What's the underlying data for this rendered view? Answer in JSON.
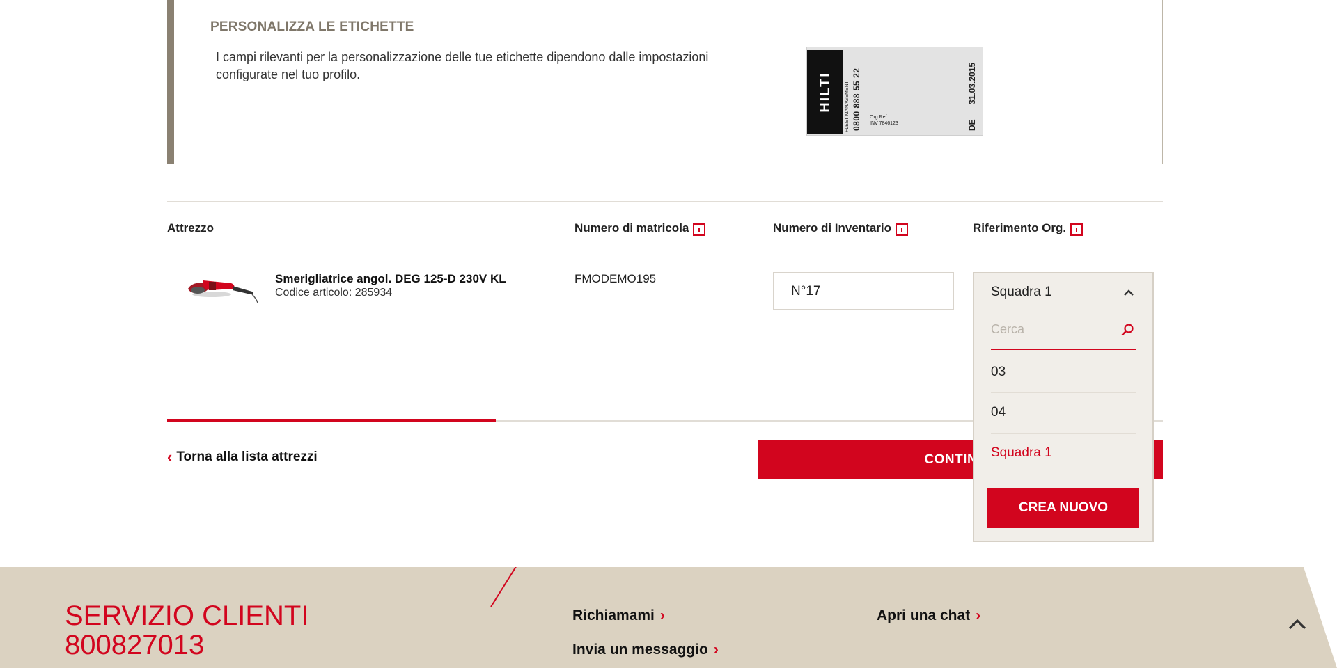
{
  "personalize": {
    "title": "PERSONALIZZA LE ETICHETTE",
    "description": "I campi rilevanti per la personalizzazione delle tue etichette dipendono dalle impostazioni configurate nel tuo profilo."
  },
  "label_sample": {
    "logo": "HILTI",
    "subline": "FLEET MANAGEMENT",
    "phone": "0800 888 55 22",
    "org_ref": "Org.Ref.",
    "org_value": "INV 7846123",
    "country": "DE",
    "date": "31.03.2015"
  },
  "table": {
    "headers": {
      "tool": "Attrezzo",
      "serial": "Numero di matricola",
      "inventory": "Numero di Inventario",
      "org_ref": "Riferimento Org."
    },
    "row": {
      "name": "Smerigliatrice angol. DEG 125-D 230V KL",
      "code": "Codice articolo: 285934",
      "serial": "FMODEMO195",
      "inventory": "N°17"
    }
  },
  "dropdown": {
    "selected": "Squadra 1",
    "search_placeholder": "Cerca",
    "options": [
      "03",
      "04",
      "Squadra 1"
    ],
    "create_label": "CREA NUOVO"
  },
  "nav": {
    "back": "Torna alla lista attrezzi",
    "continue": "CONTINUA",
    "progress": 0.33
  },
  "footer": {
    "title": "SERVIZIO CLIENTI",
    "phone": "800827013",
    "links": {
      "callback": "Richiamami",
      "message": "Invia un messaggio",
      "chat": "Apri una chat"
    }
  },
  "colors": {
    "accent": "#d2051e",
    "footer_bg": "#dbd2c1",
    "box_border": "#8a8172"
  },
  "icons": [
    "info-icon",
    "chevron-up-icon",
    "search-icon",
    "chevron-left-icon",
    "chevron-right-icon",
    "back-to-top-icon"
  ]
}
